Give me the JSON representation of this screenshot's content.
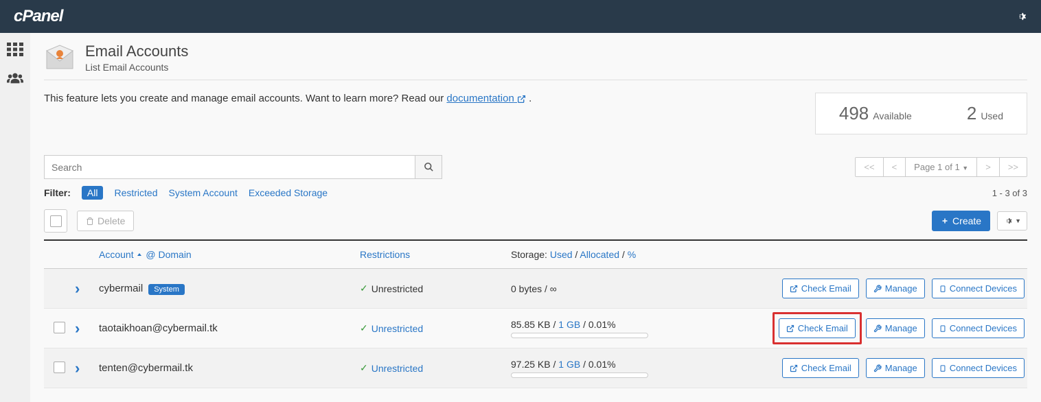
{
  "header": {
    "logo": "cPanel"
  },
  "page": {
    "title": "Email Accounts",
    "subtitle": "List Email Accounts",
    "intro_prefix": "This feature lets you create and manage email accounts. Want to learn more? Read our ",
    "doc_link": "documentation",
    "intro_suffix": " ."
  },
  "stats": {
    "available_num": "498",
    "available_label": "Available",
    "used_num": "2",
    "used_label": "Used"
  },
  "search": {
    "placeholder": "Search"
  },
  "pager": {
    "first": "<<",
    "prev": "<",
    "page_label": "Page 1 of 1",
    "next": ">",
    "last": ">>"
  },
  "filters": {
    "label": "Filter:",
    "all": "All",
    "restricted": "Restricted",
    "system": "System Account",
    "exceeded": "Exceeded Storage"
  },
  "count": "1 - 3 of 3",
  "actions": {
    "delete": "Delete",
    "create": "Create"
  },
  "columns": {
    "account": "Account",
    "domain": "@ Domain",
    "restrictions": "Restrictions",
    "storage_prefix": "Storage: ",
    "used": "Used",
    "allocated": "Allocated",
    "percent": "%"
  },
  "row_actions": {
    "check": "Check Email",
    "manage": "Manage",
    "connect": "Connect Devices"
  },
  "rows": [
    {
      "account": "cybermail",
      "is_system": true,
      "system_label": "System",
      "restriction": "Unrestricted",
      "restriction_link": false,
      "storage": "0 bytes / ∞",
      "progress": false,
      "highlight": false,
      "checkbox": false
    },
    {
      "account": "taotaikhoan@cybermail.tk",
      "is_system": false,
      "restriction": "Unrestricted",
      "restriction_link": true,
      "storage": "85.85 KB / 1 GB / 0.01%",
      "progress": true,
      "highlight": true,
      "checkbox": true
    },
    {
      "account": "tenten@cybermail.tk",
      "is_system": false,
      "restriction": "Unrestricted",
      "restriction_link": true,
      "storage": "97.25 KB / 1 GB / 0.01%",
      "progress": true,
      "highlight": false,
      "checkbox": true
    }
  ]
}
